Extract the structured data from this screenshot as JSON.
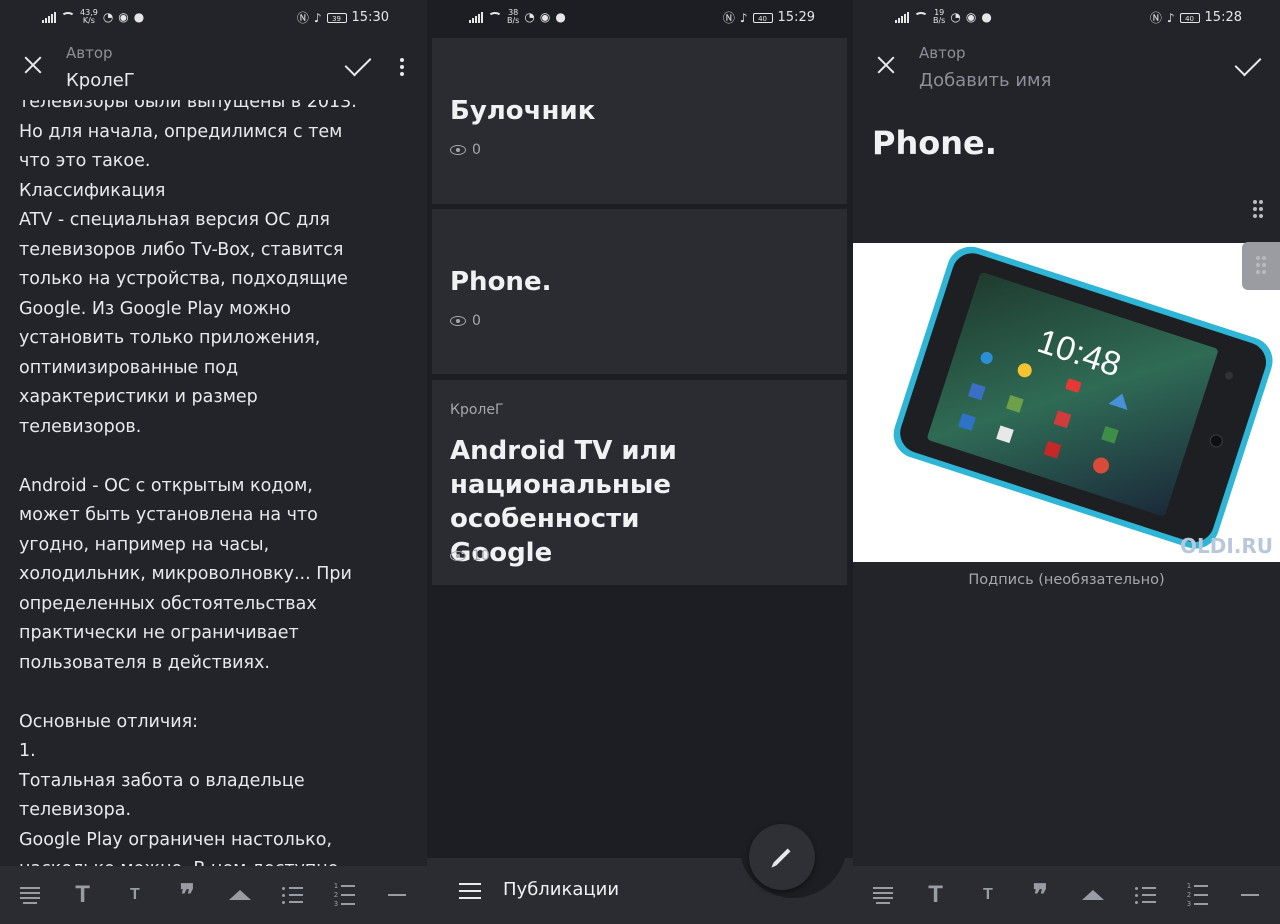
{
  "status_bars": [
    {
      "speed_top": "43,9",
      "speed_bottom": "K/s",
      "battery": "39",
      "time": "15:30"
    },
    {
      "speed_top": "38",
      "speed_bottom": "B/s",
      "battery": "40",
      "time": "15:29"
    },
    {
      "speed_top": "19",
      "speed_bottom": "B/s",
      "battery": "40",
      "time": "15:28"
    }
  ],
  "editor": {
    "author_label": "Автор",
    "author_name": "КролеГ",
    "partial_top_line": "телевизоры были выпущены в 2013.",
    "paragraphs": [
      "Но для начала, опредилимся с тем\nчто это такое.",
      "Классификация",
      "ATV - специальная версия ОС для\nтелевизоров либо Tv-Box, ставится\nтолько на устройства, подходящие\nGoogle. Из Google Play можно\nустановить только приложения,\nоптимизированные под\nхарактеристики и размер\nтелевизоров.",
      "",
      "Android - ОС с открытым кодом,\nможет быть установлена на что\nугодно, например на часы,\nхолодильник, микроволновку... При\nопределенных обстоятельствах\nпрактически не ограничивает\nпользователя в действиях.",
      "",
      "Основные отличия:",
      "1.",
      "Тотальная забота о владельце\nтелевизора.",
      "Google Play ограничен настолько,\nнасколько можно. В нем доступно"
    ]
  },
  "toolbar": {
    "icons": [
      "paragraph-icon",
      "heading-large-icon",
      "heading-small-icon",
      "quote-icon",
      "image-icon",
      "bulleted-list-icon",
      "numbered-list-icon",
      "divider-icon"
    ],
    "big_t": "T",
    "small_t": "T",
    "quote": "❞",
    "numbers": [
      "1",
      "2",
      "3"
    ]
  },
  "publications": {
    "cards": [
      {
        "title": "Булочник",
        "views": "0"
      },
      {
        "title": "Phone.",
        "views": "0"
      },
      {
        "author": "КролеГ",
        "title": "Android TV или\nнациональные особенности\nGoogle",
        "views": "10"
      }
    ],
    "nav_label": "Публикации"
  },
  "new_post": {
    "author_label": "Автор",
    "name_placeholder": "Добавить имя",
    "title": "Phone.",
    "phone_time": "10:48",
    "watermark": "OLDI.RU",
    "caption_placeholder": "Подпись (необязательно)"
  }
}
